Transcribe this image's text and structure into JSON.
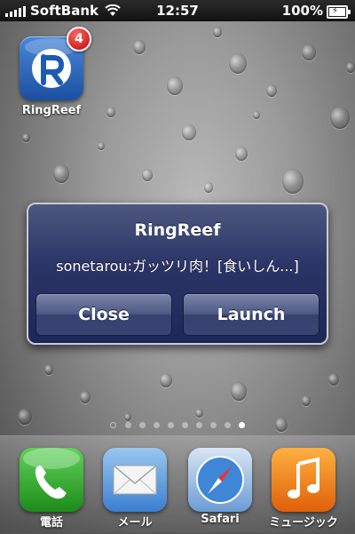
{
  "status_bar": {
    "carrier": "SoftBank",
    "time": "12:57",
    "battery": "100%"
  },
  "home": {
    "app_label": "RingReef",
    "badge_count": "4"
  },
  "alert": {
    "title": "RingReef",
    "message": "sonetarou:ガッツリ肉！[食いしん...]",
    "close_label": "Close",
    "launch_label": "Launch"
  },
  "page_indicator": {
    "pages": 9,
    "active_index": 8
  },
  "dock": {
    "items": [
      {
        "label": "電話",
        "icon": "phone-icon"
      },
      {
        "label": "メール",
        "icon": "mail-icon"
      },
      {
        "label": "Safari",
        "icon": "safari-compass-icon"
      },
      {
        "label": "ミュージック",
        "icon": "music-note-icon"
      }
    ]
  }
}
